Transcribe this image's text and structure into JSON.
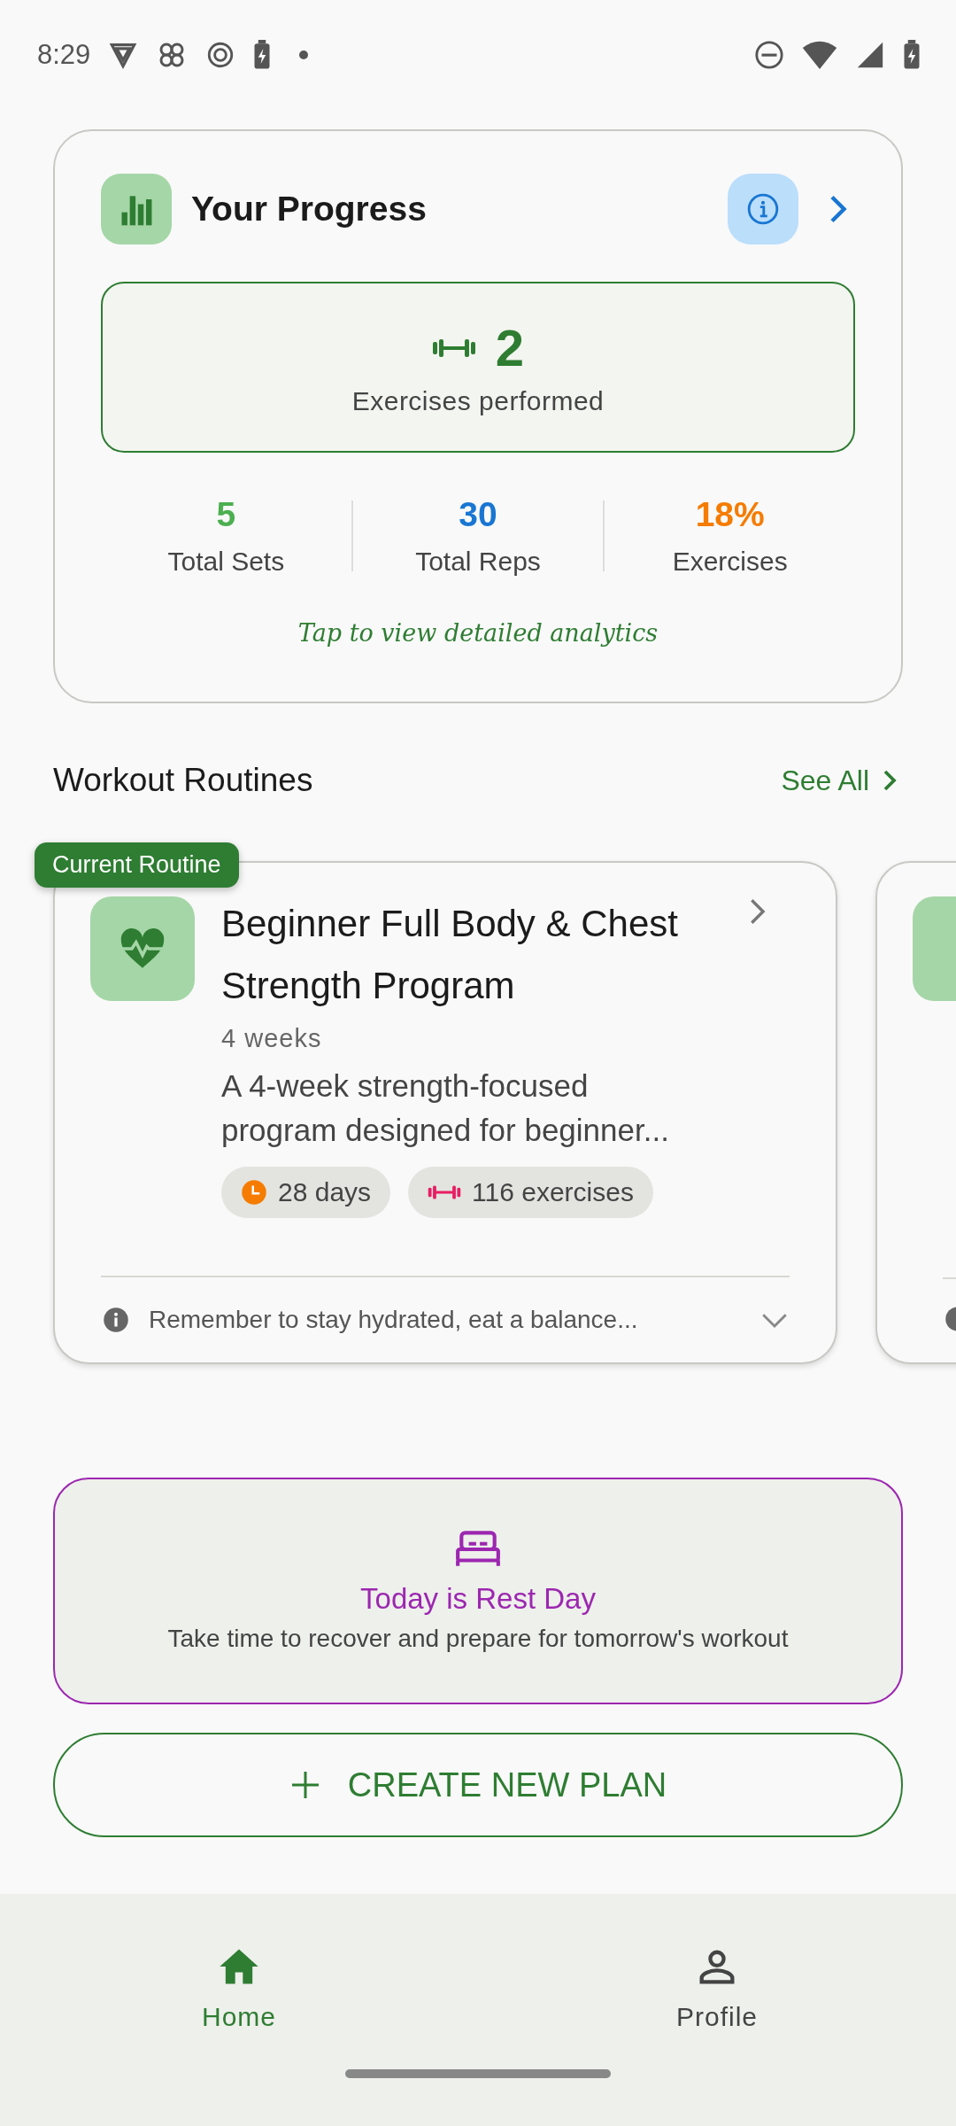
{
  "status_bar": {
    "time": "8:29"
  },
  "progress": {
    "title": "Your Progress",
    "highlight": {
      "value": "2",
      "label": "Exercises performed"
    },
    "stats": [
      {
        "value": "5",
        "label": "Total Sets",
        "color": "#4caf50"
      },
      {
        "value": "30",
        "label": "Total Reps",
        "color": "#1976d2"
      },
      {
        "value": "18%",
        "label": "Exercises",
        "color": "#f57c00"
      }
    ],
    "hint": "Tap to view detailed analytics"
  },
  "routines": {
    "title": "Workout Routines",
    "see_all": "See All",
    "cards": [
      {
        "badge": "Current Routine",
        "title": "Beginner Full Body & Chest Strength Program",
        "duration": "4 weeks",
        "description": "A 4-week strength-focused program designed for beginner...",
        "chips": [
          {
            "kind": "days",
            "text": "28 days"
          },
          {
            "kind": "exercises",
            "text": "116 exercises"
          }
        ],
        "note": "Remember to stay hydrated, eat a balance...",
        "expanded": false
      }
    ]
  },
  "rest_day": {
    "title": "Today is Rest Day",
    "message": "Take time to recover and prepare for tomorrow's workout"
  },
  "create_button": {
    "label": "CREATE NEW PLAN"
  },
  "nav": [
    {
      "label": "Home",
      "kind": "home",
      "selected": true
    },
    {
      "label": "Profile",
      "kind": "profile",
      "selected": false
    }
  ]
}
